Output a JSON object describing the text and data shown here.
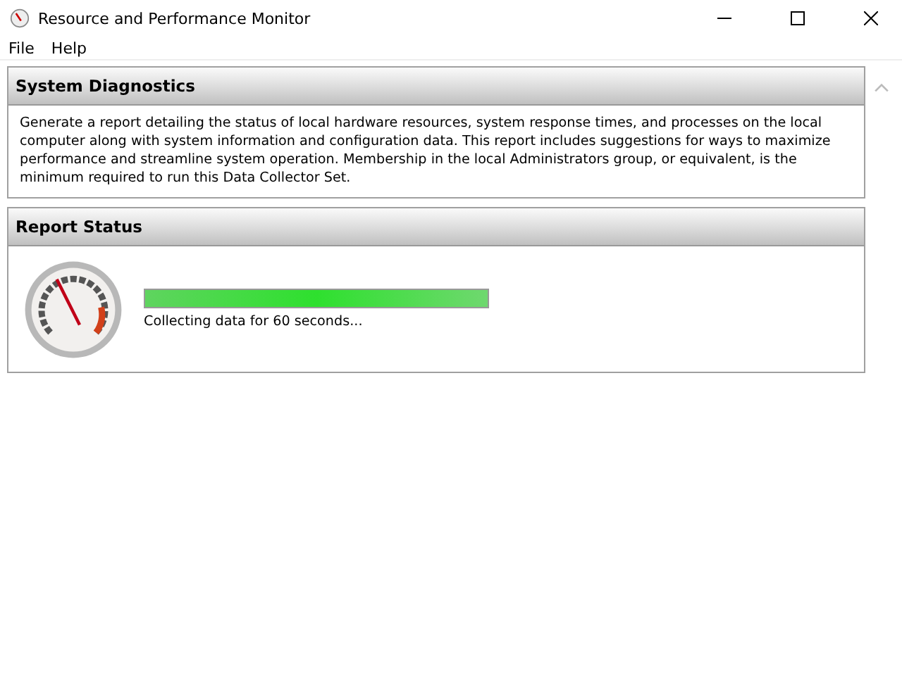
{
  "window": {
    "title": "Resource and Performance Monitor"
  },
  "menu": [
    {
      "label": "File"
    },
    {
      "label": "Help"
    }
  ],
  "panels": [
    {
      "kind": "text",
      "title": "System Diagnostics",
      "text": "Generate a report detailing the status of local hardware resources, system response times, and processes on the local computer along with system information and configuration data. This report includes suggestions for ways to maximize performance and streamline system operation. Membership in the local Administrators group, or equivalent, is the minimum required to run this Data Collector Set."
    },
    {
      "kind": "status",
      "title": "Report Status",
      "progress": {
        "level": 1.0,
        "caption": "Collecting data for 60 seconds..."
      }
    }
  ]
}
